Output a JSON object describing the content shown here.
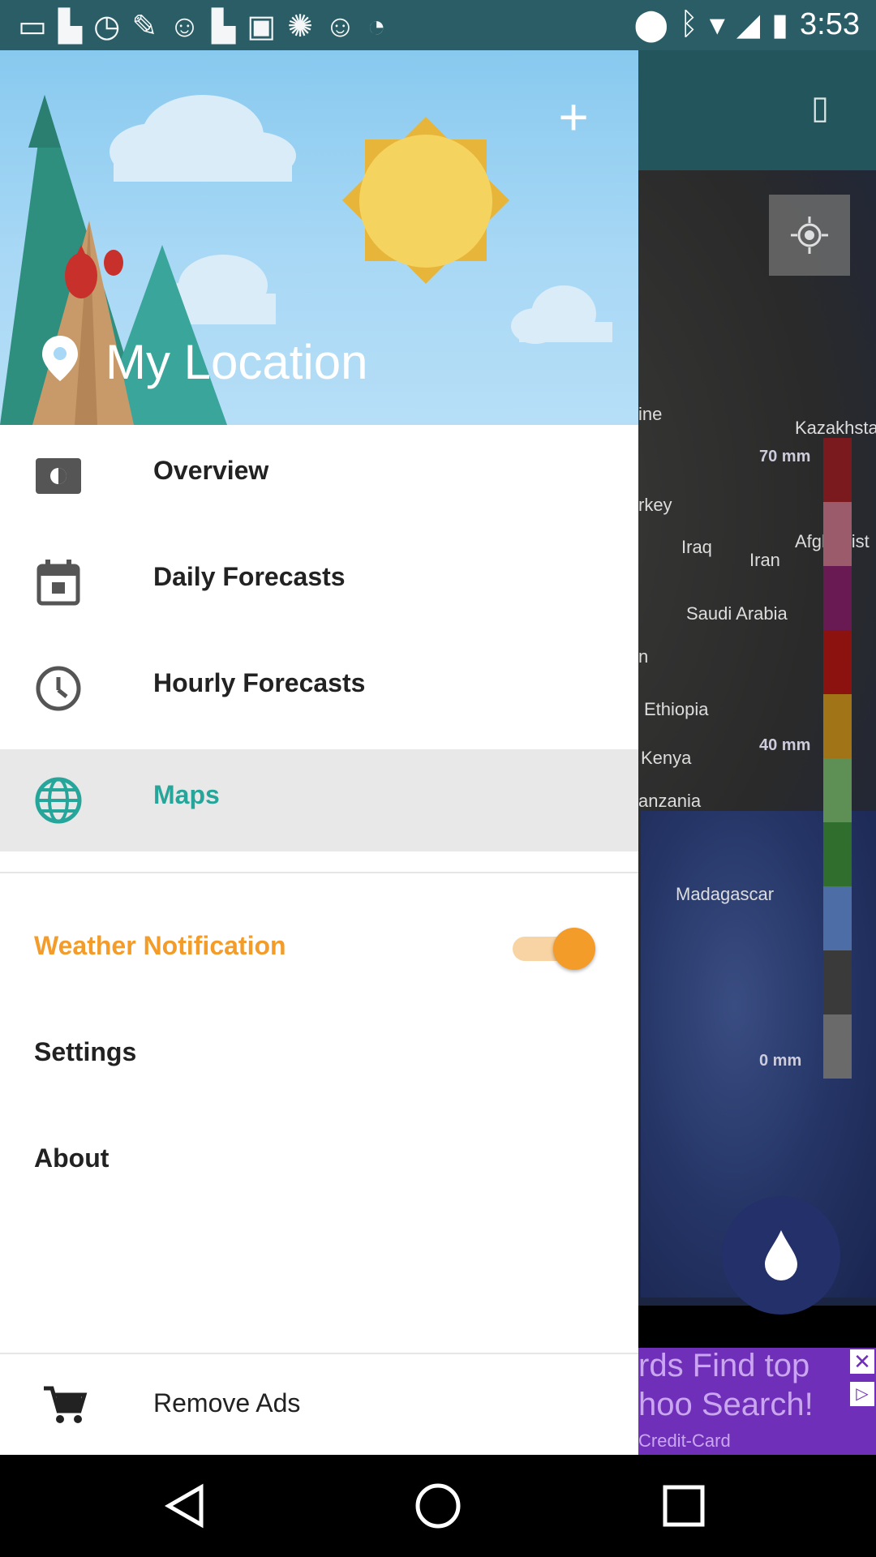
{
  "status_bar": {
    "time": "3:53",
    "left_icons": [
      "message-icon",
      "flipboard-icon",
      "timer-icon",
      "wrench-icon",
      "smiley-icon",
      "flipboard-icon",
      "qt-icon",
      "jio-icon",
      "smiley-icon",
      "timer-icon"
    ]
  },
  "drawer": {
    "header": {
      "location_label": "My Location",
      "add_button_label": "+"
    },
    "menu": [
      {
        "id": "overview",
        "label": "Overview",
        "icon": "overview-icon",
        "active": false
      },
      {
        "id": "daily",
        "label": "Daily Forecasts",
        "icon": "calendar-icon",
        "active": false
      },
      {
        "id": "hourly",
        "label": "Hourly Forecasts",
        "icon": "clock-icon",
        "active": false
      },
      {
        "id": "maps",
        "label": "Maps",
        "icon": "globe-icon",
        "active": true
      }
    ],
    "notification": {
      "label": "Weather Notification",
      "enabled": true
    },
    "settings_label": "Settings",
    "about_label": "About",
    "remove_ads_label": "Remove Ads"
  },
  "map": {
    "labels": [
      "Kazakhsta",
      "ine",
      "rkey",
      "Iraq",
      "Iran",
      "Afghanist",
      "Saudi Arabia",
      "n",
      "Ethiopia",
      "Kenya",
      "anzania",
      "Madagascar"
    ],
    "legend": {
      "top_label": "70 mm",
      "mid_label": "40 mm",
      "bottom_label": "0 mm",
      "colors": [
        "#7a1a1e",
        "#9b5b6b",
        "#6a1a52",
        "#8c1210",
        "#a27418",
        "#5e8f55",
        "#2f6e2c",
        "#4c6da6",
        "#3a3a3a",
        "#6a6a6a"
      ]
    },
    "ad": {
      "line1": "rds Find top",
      "line2": "hoo Search!",
      "line3": "Credit-Card"
    }
  },
  "colors": {
    "accent_teal": "#26a69a",
    "notification_orange": "#f39c2a",
    "appbar_teal": "#23555c"
  }
}
